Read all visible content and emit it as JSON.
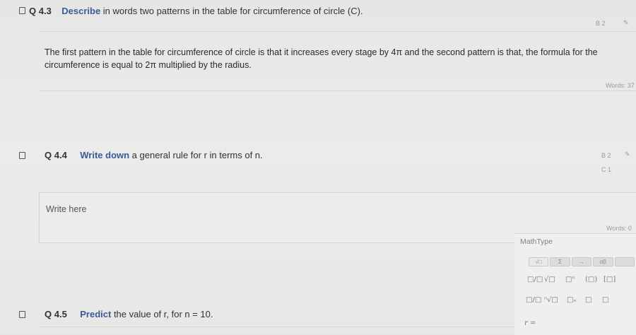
{
  "q43": {
    "number": "Q 4.3",
    "verb": "Describe",
    "text": " in words two patterns in the table for circumference of circle (C).",
    "mark": "B 2",
    "answer_line1": "The first pattern in the table for circumference of circle is that it increases every stage by 4π and the second pattern is that, the formula for the",
    "answer_line2": "circumference is equal to 2π multiplied by the radius.",
    "word_count": "Words: 37"
  },
  "q44": {
    "number": "Q 4.4",
    "verb": "Write down",
    "text": " a general rule for r in terms of n.",
    "mark1": "B 2",
    "mark2": "C 1",
    "placeholder": "Write here",
    "word_count": "Words: 0"
  },
  "q45": {
    "number": "Q 4.5",
    "verb": "Predict",
    "text": " the value of r, for n = 10."
  },
  "mathtype": {
    "title": "MathType",
    "tabs": [
      "√□",
      "Σ",
      "→",
      "αβ",
      ""
    ],
    "row1": [
      "□/□",
      "√□",
      "□ⁿ",
      "(□)",
      "[□]"
    ],
    "row2": [
      "□/□",
      "ⁿ√□",
      "□ₙ",
      "□",
      "□"
    ],
    "field": "r ="
  }
}
